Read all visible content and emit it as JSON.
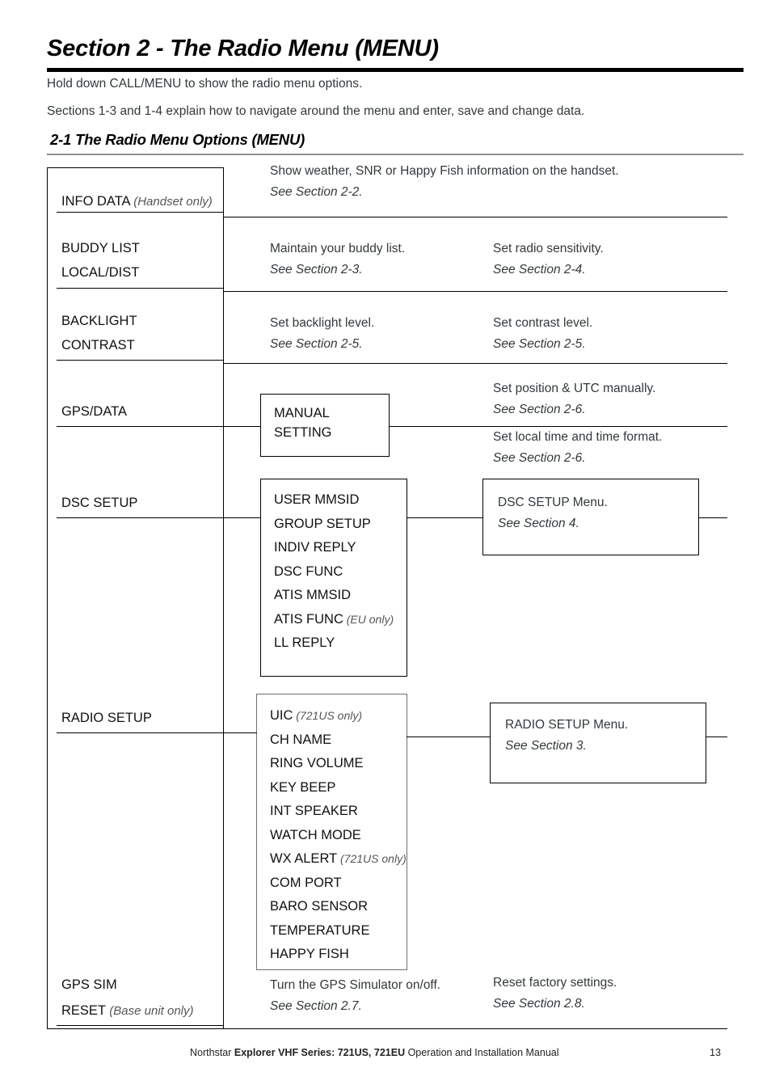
{
  "header": {
    "title": "Section 2 - The Radio Menu (MENU)",
    "intro_1": "Hold down CALL/MENU to show the radio menu options.",
    "intro_2": "Sections 1-3 and 1-4 explain how to navigate around the menu and enter, save and change data.",
    "subsection_title": "2-1 The Radio Menu Options (MENU)"
  },
  "menu_rows": [
    {
      "labels": [
        "INFO DATA "
      ],
      "label_qualifier": "(Handset only)",
      "desc_a": "Show weather, SNR or Happy Fish information on the handset.",
      "see_a": "See Section 2-2.",
      "desc_b": "",
      "see_b": ""
    },
    {
      "label_1": "BUDDY LIST",
      "label_2": "LOCAL/DIST",
      "desc_a": "Maintain your buddy list.",
      "see_a": "See Section 2-3.",
      "desc_b": "Set radio sensitivity.",
      "see_b": "See Section 2-4."
    },
    {
      "label_1": "BACKLIGHT",
      "label_2": "CONTRAST",
      "desc_a": "Set backlight level.",
      "see_a": "See Section 2-5.",
      "desc_b": "Set contrast level.",
      "see_b": "See Section 2-5."
    }
  ],
  "gps_data": {
    "label": "GPS/DATA",
    "submenu": {
      "line_1": "MANUAL",
      "line_2": "SETTING"
    },
    "desc_upper": "Set position & UTC manually.",
    "see_upper": "See Section 2-6.",
    "desc_lower": "Set local time and time format.",
    "see_lower": "See Section 2-6."
  },
  "dsc_setup": {
    "label": "DSC SETUP",
    "submenu_items": [
      {
        "name": "USER MMSID",
        "qualifier": ""
      },
      {
        "name": "GROUP SETUP",
        "qualifier": ""
      },
      {
        "name": "INDIV REPLY",
        "qualifier": ""
      },
      {
        "name": "DSC FUNC",
        "qualifier": ""
      },
      {
        "name": "ATIS MMSID",
        "qualifier": ""
      },
      {
        "name": "ATIS FUNC",
        "qualifier": "(EU only)"
      },
      {
        "name": "LL REPLY",
        "qualifier": ""
      }
    ],
    "note": "DSC SETUP Menu.",
    "note_see": "See Section 4."
  },
  "radio_setup": {
    "label": "RADIO SETUP",
    "submenu_items": [
      {
        "name": "UIC",
        "qualifier": "(721US only)"
      },
      {
        "name": "CH NAME",
        "qualifier": ""
      },
      {
        "name": "RING VOLUME",
        "qualifier": ""
      },
      {
        "name": "KEY BEEP",
        "qualifier": ""
      },
      {
        "name": "INT SPEAKER",
        "qualifier": ""
      },
      {
        "name": "WATCH MODE",
        "qualifier": ""
      },
      {
        "name": "WX ALERT",
        "qualifier": "(721US only)"
      },
      {
        "name": "COM PORT",
        "qualifier": ""
      },
      {
        "name": "BARO SENSOR",
        "qualifier": ""
      },
      {
        "name": "TEMPERATURE",
        "qualifier": ""
      },
      {
        "name": "HAPPY FISH",
        "qualifier": ""
      }
    ],
    "note": "RADIO SETUP Menu.",
    "note_see": "See Section 3."
  },
  "bottom_row": {
    "label_1": "GPS SIM",
    "label_2": "RESET ",
    "label_2_qualifier": "(Base unit only)",
    "desc_a": "Turn the GPS Simulator on/off.",
    "see_a": "See Section 2.7.",
    "desc_b": "Reset factory settings.",
    "see_b": "See Section 2.8."
  },
  "footer": {
    "brand": "Northstar ",
    "product": "Explorer VHF Series: 721US, 721EU",
    "suffix": " Operation and Installation Manual",
    "page_number": "13"
  }
}
